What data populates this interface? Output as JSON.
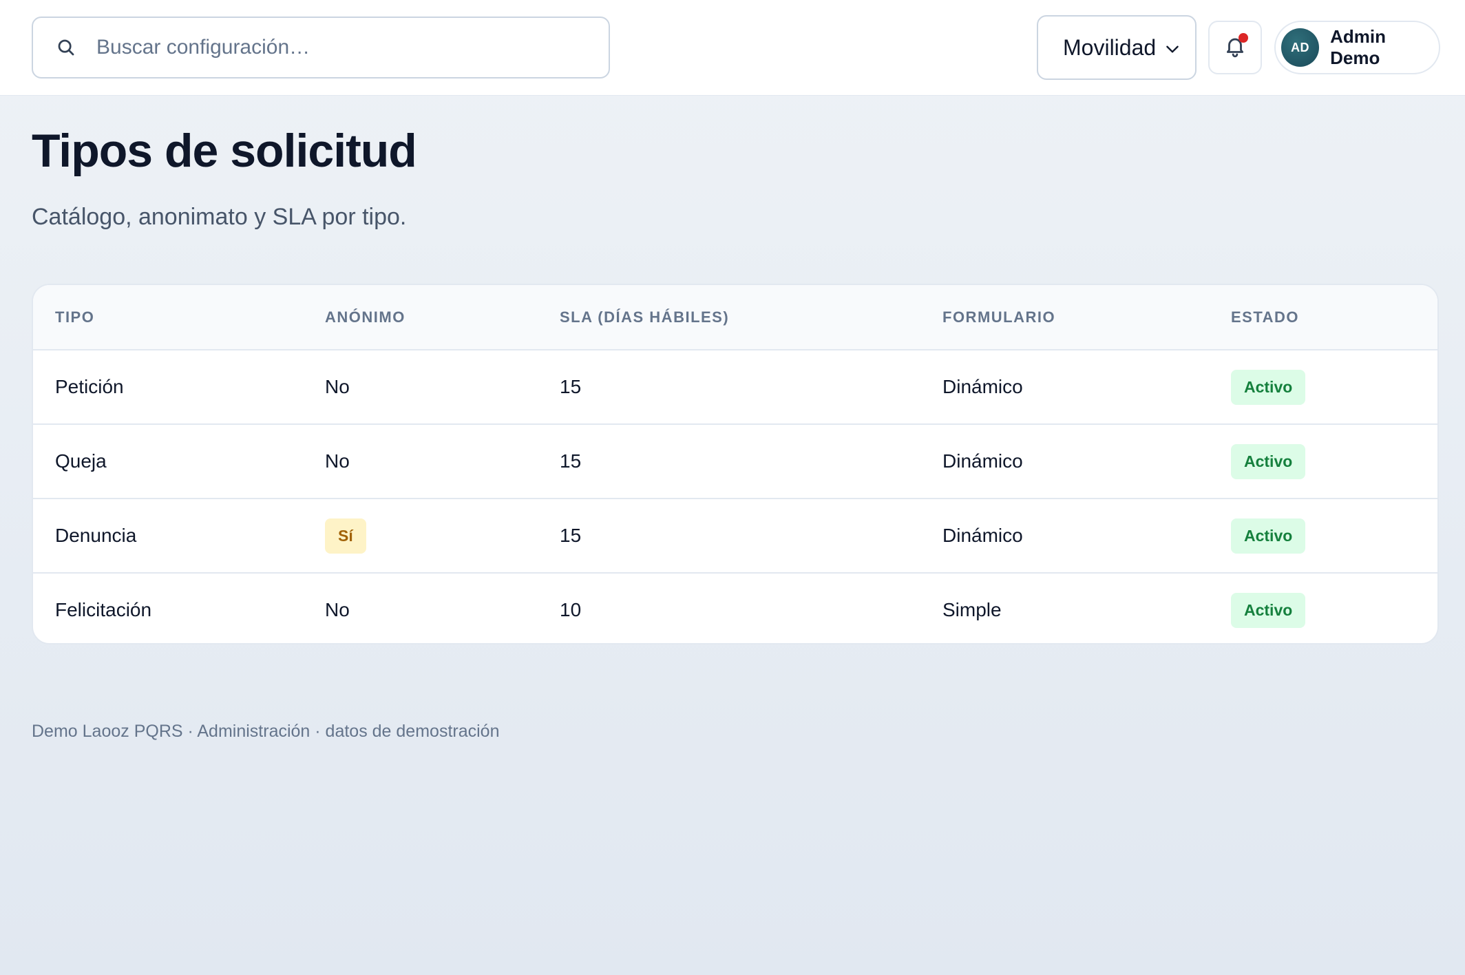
{
  "search": {
    "placeholder": "Buscar configuración…",
    "value": ""
  },
  "project_select": {
    "selected": "Movilidad"
  },
  "notifications": {
    "has_unread": true,
    "dot_color": "#dc2626"
  },
  "user": {
    "initials": "AD",
    "name": "Admin Demo"
  },
  "page": {
    "title": "Tipos de solicitud",
    "subtitle": "Catálogo, anonimato y SLA por tipo."
  },
  "table": {
    "headers": [
      "TIPO",
      "ANÓNIMO",
      "SLA (DÍAS HÁBILES)",
      "FORMULARIO",
      "ESTADO"
    ],
    "rows": [
      {
        "tipo": "Petición",
        "anonimo": "No",
        "anonimo_badge": false,
        "sla": "15",
        "formulario": "Dinámico",
        "estado": "Activo"
      },
      {
        "tipo": "Queja",
        "anonimo": "No",
        "anonimo_badge": false,
        "sla": "15",
        "formulario": "Dinámico",
        "estado": "Activo"
      },
      {
        "tipo": "Denuncia",
        "anonimo": "Sí",
        "anonimo_badge": true,
        "sla": "15",
        "formulario": "Dinámico",
        "estado": "Activo"
      },
      {
        "tipo": "Felicitación",
        "anonimo": "No",
        "anonimo_badge": false,
        "sla": "10",
        "formulario": "Simple",
        "estado": "Activo"
      }
    ]
  },
  "footer": {
    "text": "Demo Laooz PQRS · Administración · datos de demostración"
  },
  "colors": {
    "status_active_bg": "#dcfce7",
    "status_active_text": "#15803d",
    "anon_yes_bg": "#fef3c7",
    "anon_yes_text": "#a16207"
  }
}
